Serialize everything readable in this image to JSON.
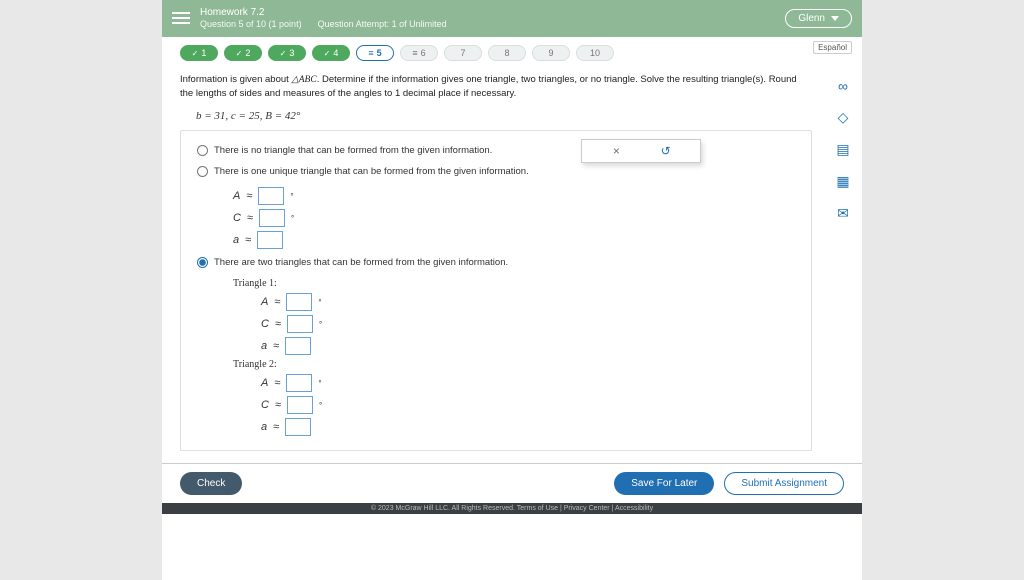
{
  "header": {
    "title": "Homework 7.2",
    "question_pos": "Question 5 of 10 (1 point)",
    "attempt": "Question Attempt: 1 of Unlimited",
    "user": "Glenn"
  },
  "lang": "Español",
  "nav": {
    "items": [
      {
        "n": "1",
        "state": "done"
      },
      {
        "n": "2",
        "state": "done"
      },
      {
        "n": "3",
        "state": "done"
      },
      {
        "n": "4",
        "state": "done"
      },
      {
        "n": "5",
        "state": "current",
        "prefix": "≡"
      },
      {
        "n": "6",
        "state": "pending",
        "prefix": "≡"
      },
      {
        "n": "7",
        "state": "pending"
      },
      {
        "n": "8",
        "state": "pending"
      },
      {
        "n": "9",
        "state": "pending"
      },
      {
        "n": "10",
        "state": "pending"
      }
    ]
  },
  "prompt": {
    "lead": "Information is given about ",
    "tri": "△ABC",
    "rest": ". Determine if the information gives one triangle, two triangles, or no triangle. Solve the resulting triangle(s). Round the lengths of sides and measures of the angles to 1 decimal place if necessary."
  },
  "given": "b = 31,  c = 25,  B = 42°",
  "options": {
    "none": "There is no triangle that can be formed from the given information.",
    "one": "There is one unique triangle that can be formed from the given information.",
    "two": "There are two triangles that can be formed from the given information."
  },
  "labels": {
    "A": "A",
    "C": "C",
    "a": "a",
    "approx": "≈",
    "tri1": "Triangle 1:",
    "tri2": "Triangle 2:"
  },
  "toolbar": {
    "x": "×",
    "reset": "↺"
  },
  "footer": {
    "check": "Check",
    "save": "Save For Later",
    "submit": "Submit Assignment",
    "legal": "© 2023 McGraw Hill LLC. All Rights Reserved.   Terms of Use  |  Privacy Center  |  Accessibility"
  }
}
